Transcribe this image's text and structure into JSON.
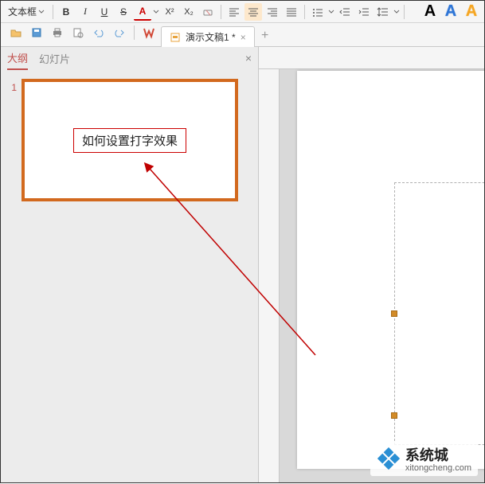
{
  "toolbar1": {
    "textbox_label": "文本框",
    "bold": "B",
    "italic": "I",
    "underline": "U",
    "strike": "S",
    "fontcolor": "A",
    "superscript": "X²",
    "subscript": "X₂"
  },
  "wordart": {
    "a_black": "A",
    "a_blue": "A",
    "a_orange": "A"
  },
  "doc_tab": {
    "title": "演示文稿1 *",
    "close": "×",
    "add": "+"
  },
  "panel": {
    "tab_outline": "大纲",
    "tab_slides": "幻灯片",
    "close": "×"
  },
  "thumbs": [
    {
      "num": "1",
      "text": "如何设置打字效果"
    }
  ],
  "watermark": {
    "title": "系统城",
    "sub": "xitongcheng.com"
  }
}
